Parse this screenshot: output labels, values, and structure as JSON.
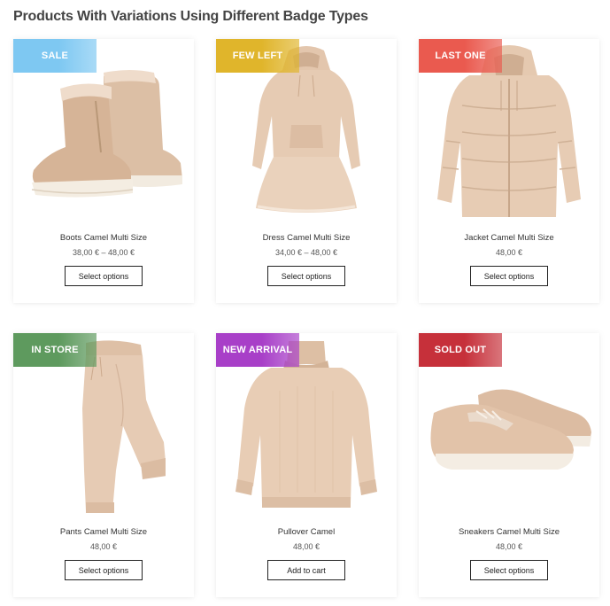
{
  "page": {
    "title": "Products With Variations Using Different Badge Types"
  },
  "products": [
    {
      "name": "Boots Camel Multi Size",
      "price": "38,00 € – 48,00 €",
      "badge": "SALE",
      "badge_color": "#7ec8f2",
      "button": "Select options",
      "icon": "boots-icon"
    },
    {
      "name": "Dress Camel Multi Size",
      "price": "34,00 € – 48,00 €",
      "badge": "FEW LEFT",
      "badge_color": "#e0b52b",
      "button": "Select options",
      "icon": "dress-icon"
    },
    {
      "name": "Jacket Camel Multi Size",
      "price": "48,00 €",
      "badge": "LAST ONE",
      "badge_color": "#ea5a4f",
      "button": "Select options",
      "icon": "jacket-icon"
    },
    {
      "name": "Pants Camel Multi Size",
      "price": "48,00 €",
      "badge": "IN STORE",
      "badge_color": "#5e9a5e",
      "button": "Select options",
      "icon": "pants-icon"
    },
    {
      "name": "Pullover Camel",
      "price": "48,00 €",
      "badge": "NEW ARRIVAL",
      "badge_color": "#a83fc8",
      "button": "Add to cart",
      "icon": "pullover-icon"
    },
    {
      "name": "Sneakers Camel Multi Size",
      "price": "48,00 €",
      "badge": "SOLD OUT",
      "badge_color": "#c6303a",
      "button": "Select options",
      "icon": "sneakers-icon"
    }
  ]
}
